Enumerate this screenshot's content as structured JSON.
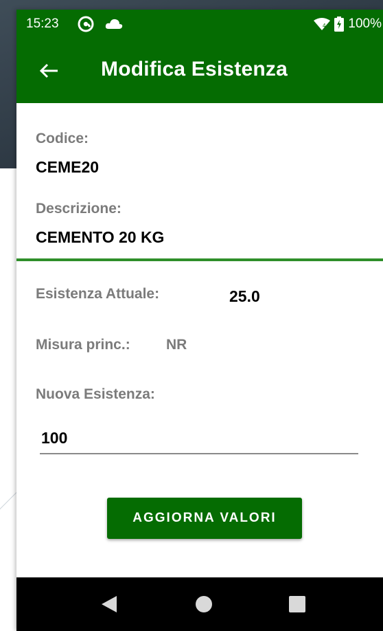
{
  "status_bar": {
    "time": "15:23",
    "battery_percent": "100%",
    "icons": [
      "at-sign-icon",
      "cloud-icon",
      "wifi-icon",
      "battery-charging-icon"
    ],
    "background": "#056c02"
  },
  "app_bar": {
    "title": "Modifica Esistenza",
    "back_icon": "arrow-left-icon",
    "background": "#056c02"
  },
  "item": {
    "code_label": "Codice:",
    "code_value": "CEME20",
    "description_label": "Descrizione:",
    "description_value": "CEMENTO 20 KG"
  },
  "stock": {
    "current_label": "Esistenza Attuale:",
    "current_value": "25.0",
    "unit_label": "Misura princ.:",
    "unit_value": "NR",
    "new_label": "Nuova Esistenza:",
    "new_value": "100"
  },
  "actions": {
    "update_label": "AGGIORNA VALORI"
  },
  "nav_bar": {
    "icons": [
      "back-triangle-icon",
      "home-circle-icon",
      "recents-square-icon"
    ]
  },
  "colors": {
    "primary": "#056c02",
    "divider": "#2f8f2a",
    "label_grey": "#7b7b7b"
  }
}
